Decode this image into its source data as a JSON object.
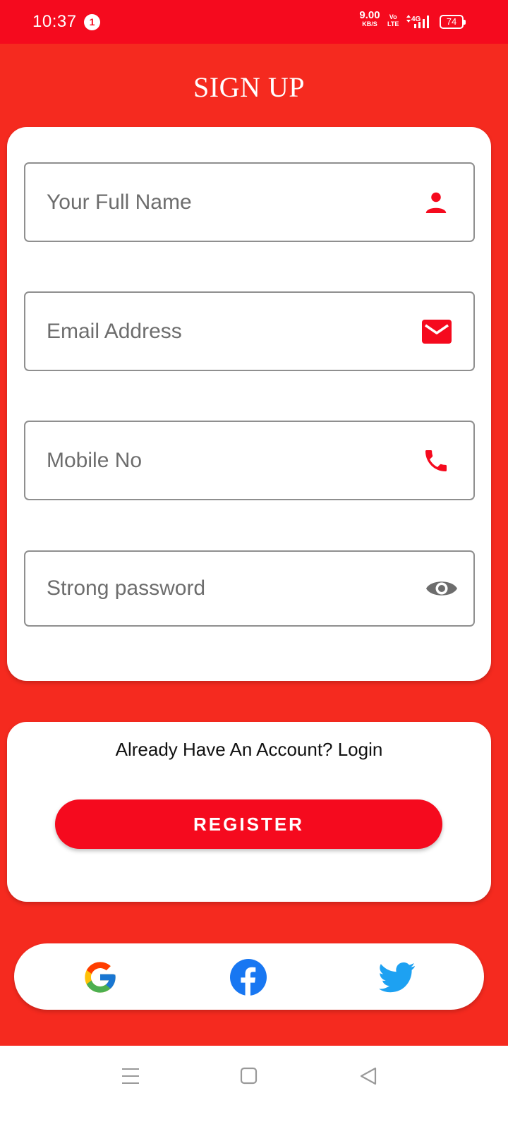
{
  "status_bar": {
    "time": "10:37",
    "notification_count": "1",
    "net_speed_value": "9.00",
    "net_speed_unit": "KB/S",
    "volte_line1": "Vo",
    "volte_line2": "LTE",
    "network_type": "4G",
    "battery_level": "74"
  },
  "header": {
    "title": "SIGN UP"
  },
  "form": {
    "full_name_placeholder": "Your Full Name",
    "email_placeholder": "Email Address",
    "mobile_placeholder": "Mobile No",
    "password_placeholder": "Strong password"
  },
  "actions": {
    "login_prompt": "Already Have An Account? Login",
    "register_label": "REGISTER"
  },
  "social": {
    "google_icon": "google-icon",
    "facebook_icon": "facebook-icon",
    "twitter_icon": "twitter-icon"
  },
  "colors": {
    "status_bar": "#f50a1e",
    "background": "#f52a1f",
    "accent": "#f50a1e",
    "card": "#ffffff",
    "field_border": "#8f8f8f",
    "placeholder": "#6d6d6d"
  }
}
